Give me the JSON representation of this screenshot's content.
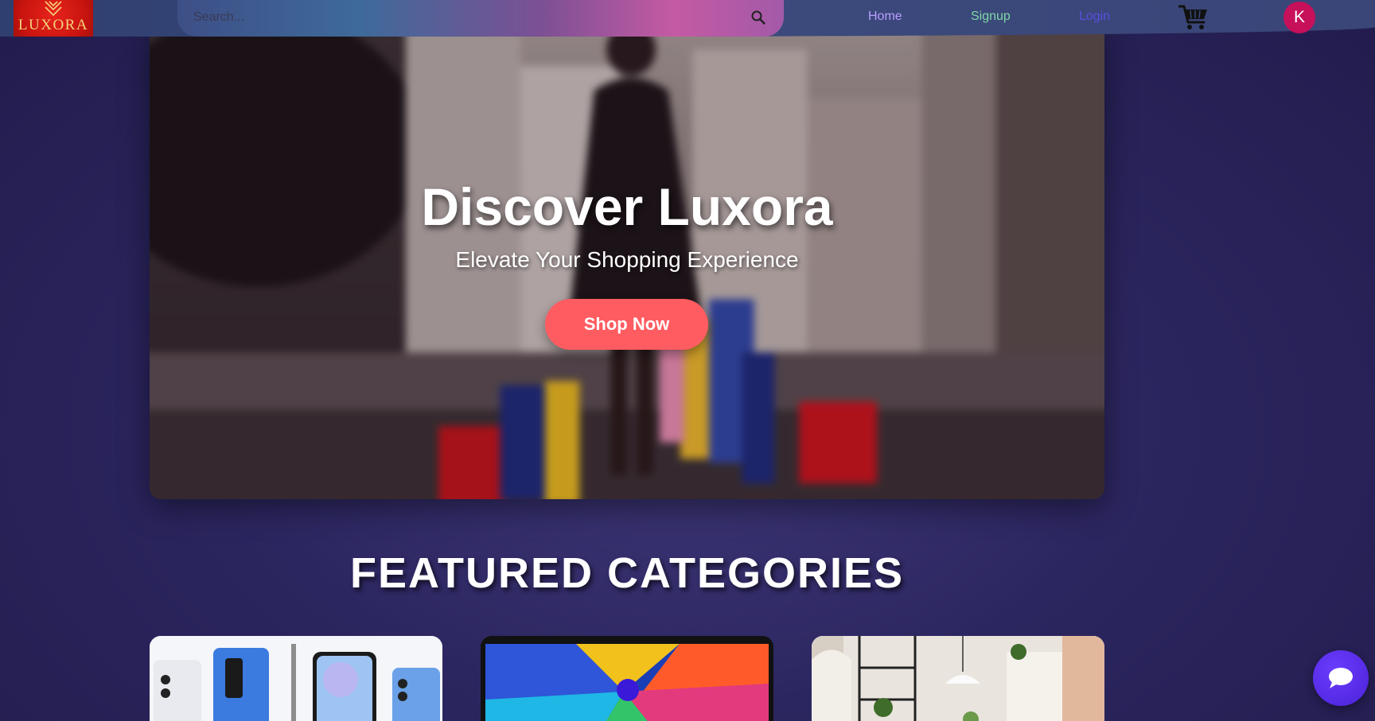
{
  "brand": {
    "logo_text": "LUXORA",
    "logo_color": "#c8140f"
  },
  "search": {
    "placeholder": "Search...",
    "value": ""
  },
  "nav": {
    "links": [
      {
        "label": "Home",
        "color": "#b99dff"
      },
      {
        "label": "Signup",
        "color": "#7fd8a6"
      },
      {
        "label": "Login",
        "color": "#5a4fe0"
      }
    ],
    "cart_icon": "shopping-cart-icon",
    "avatar_letter": "K",
    "avatar_color": "#c7105a"
  },
  "hero": {
    "title": "Discover Luxora",
    "subtitle": "Elevate Your Shopping Experience",
    "cta_label": "Shop Now",
    "cta_color": "#ff5c61"
  },
  "featured": {
    "title": "FEATURED CATEGORIES",
    "cards": [
      {
        "image": "smartphones"
      },
      {
        "image": "laptop-display"
      },
      {
        "image": "home-interior"
      }
    ]
  },
  "chat": {
    "icon": "chat-bubble-icon"
  }
}
